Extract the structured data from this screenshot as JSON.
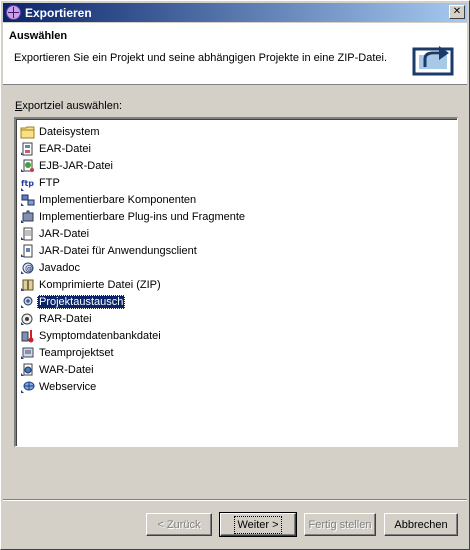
{
  "window": {
    "title": "Exportieren"
  },
  "header": {
    "title": "Auswählen",
    "description": "Exportieren Sie ein Projekt und seine abhängigen Projekte in eine ZIP-Datei."
  },
  "body": {
    "label": "Exportziel auswählen:"
  },
  "list": {
    "items": [
      {
        "label": "Dateisystem",
        "icon": "folder-icon"
      },
      {
        "label": "EAR-Datei",
        "icon": "ear-file-icon"
      },
      {
        "label": "EJB-JAR-Datei",
        "icon": "ejb-jar-file-icon"
      },
      {
        "label": "FTP",
        "icon": "ftp-icon"
      },
      {
        "label": "Implementierbare Komponenten",
        "icon": "deployable-components-icon"
      },
      {
        "label": "Implementierbare Plug-ins und Fragmente",
        "icon": "deployable-plugins-icon"
      },
      {
        "label": "JAR-Datei",
        "icon": "jar-file-icon"
      },
      {
        "label": "JAR-Datei für Anwendungsclient",
        "icon": "app-client-jar-icon"
      },
      {
        "label": "Javadoc",
        "icon": "javadoc-icon"
      },
      {
        "label": "Komprimierte Datei (ZIP)",
        "icon": "zip-file-icon"
      },
      {
        "label": "Projektaustausch",
        "icon": "project-interchange-icon",
        "selected": true
      },
      {
        "label": "RAR-Datei",
        "icon": "rar-file-icon"
      },
      {
        "label": "Symptomdatenbankdatei",
        "icon": "symptom-database-icon"
      },
      {
        "label": "Teamprojektset",
        "icon": "team-project-set-icon"
      },
      {
        "label": "WAR-Datei",
        "icon": "war-file-icon"
      },
      {
        "label": "Webservice",
        "icon": "webservice-icon"
      }
    ]
  },
  "buttons": {
    "back": "< Zurück",
    "next": "Weiter >",
    "finish": "Fertig stellen",
    "cancel": "Abbrechen"
  }
}
